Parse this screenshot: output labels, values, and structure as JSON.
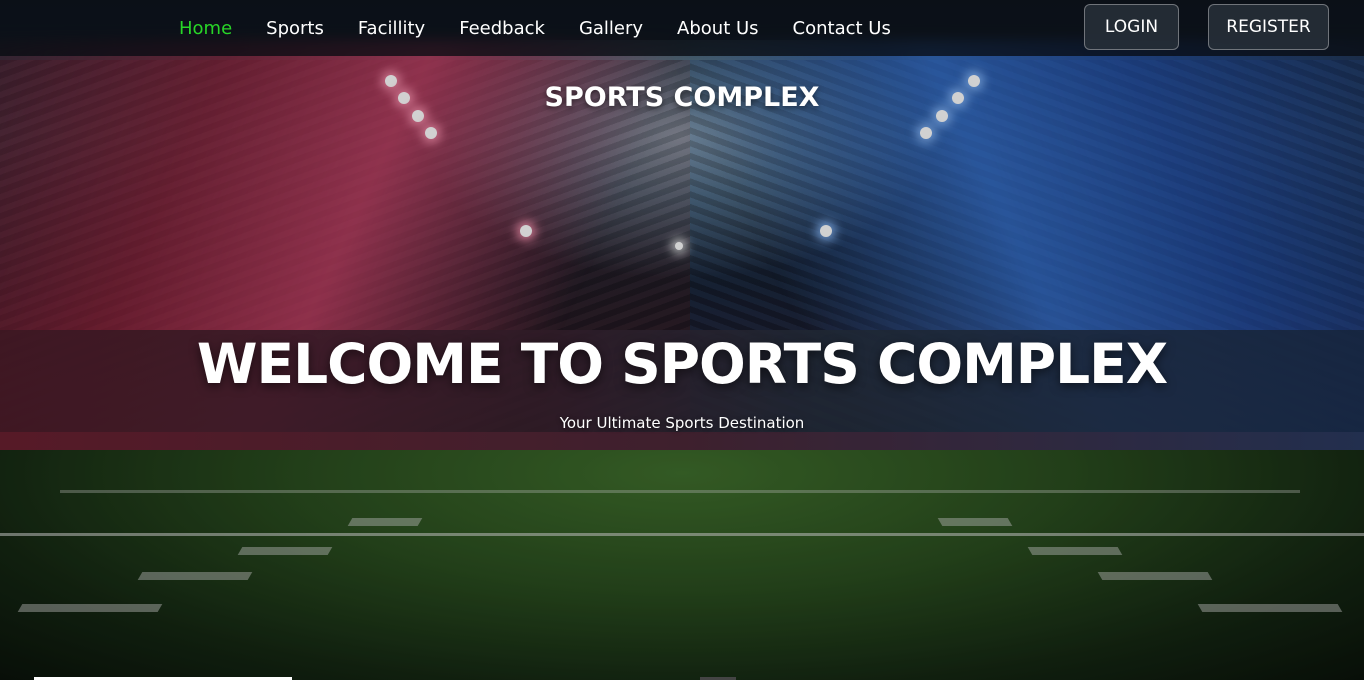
{
  "nav": {
    "links": [
      {
        "label": "Home",
        "active": true
      },
      {
        "label": "Sports",
        "active": false
      },
      {
        "label": "Facillity",
        "active": false
      },
      {
        "label": "Feedback",
        "active": false
      },
      {
        "label": "Gallery",
        "active": false
      },
      {
        "label": "About Us",
        "active": false
      },
      {
        "label": "Contact Us",
        "active": false
      }
    ],
    "login_label": "LOGIN",
    "register_label": "REGISTER"
  },
  "hero": {
    "brand": "SPORTS COMPLEX",
    "heading": "WELCOME TO SPORTS COMPLEX",
    "tagline": "Your Ultimate Sports Destination"
  },
  "colors": {
    "active_link": "#28d627",
    "text": "#ffffff",
    "navbar_bg": "rgba(8,12,18,0.78)"
  }
}
